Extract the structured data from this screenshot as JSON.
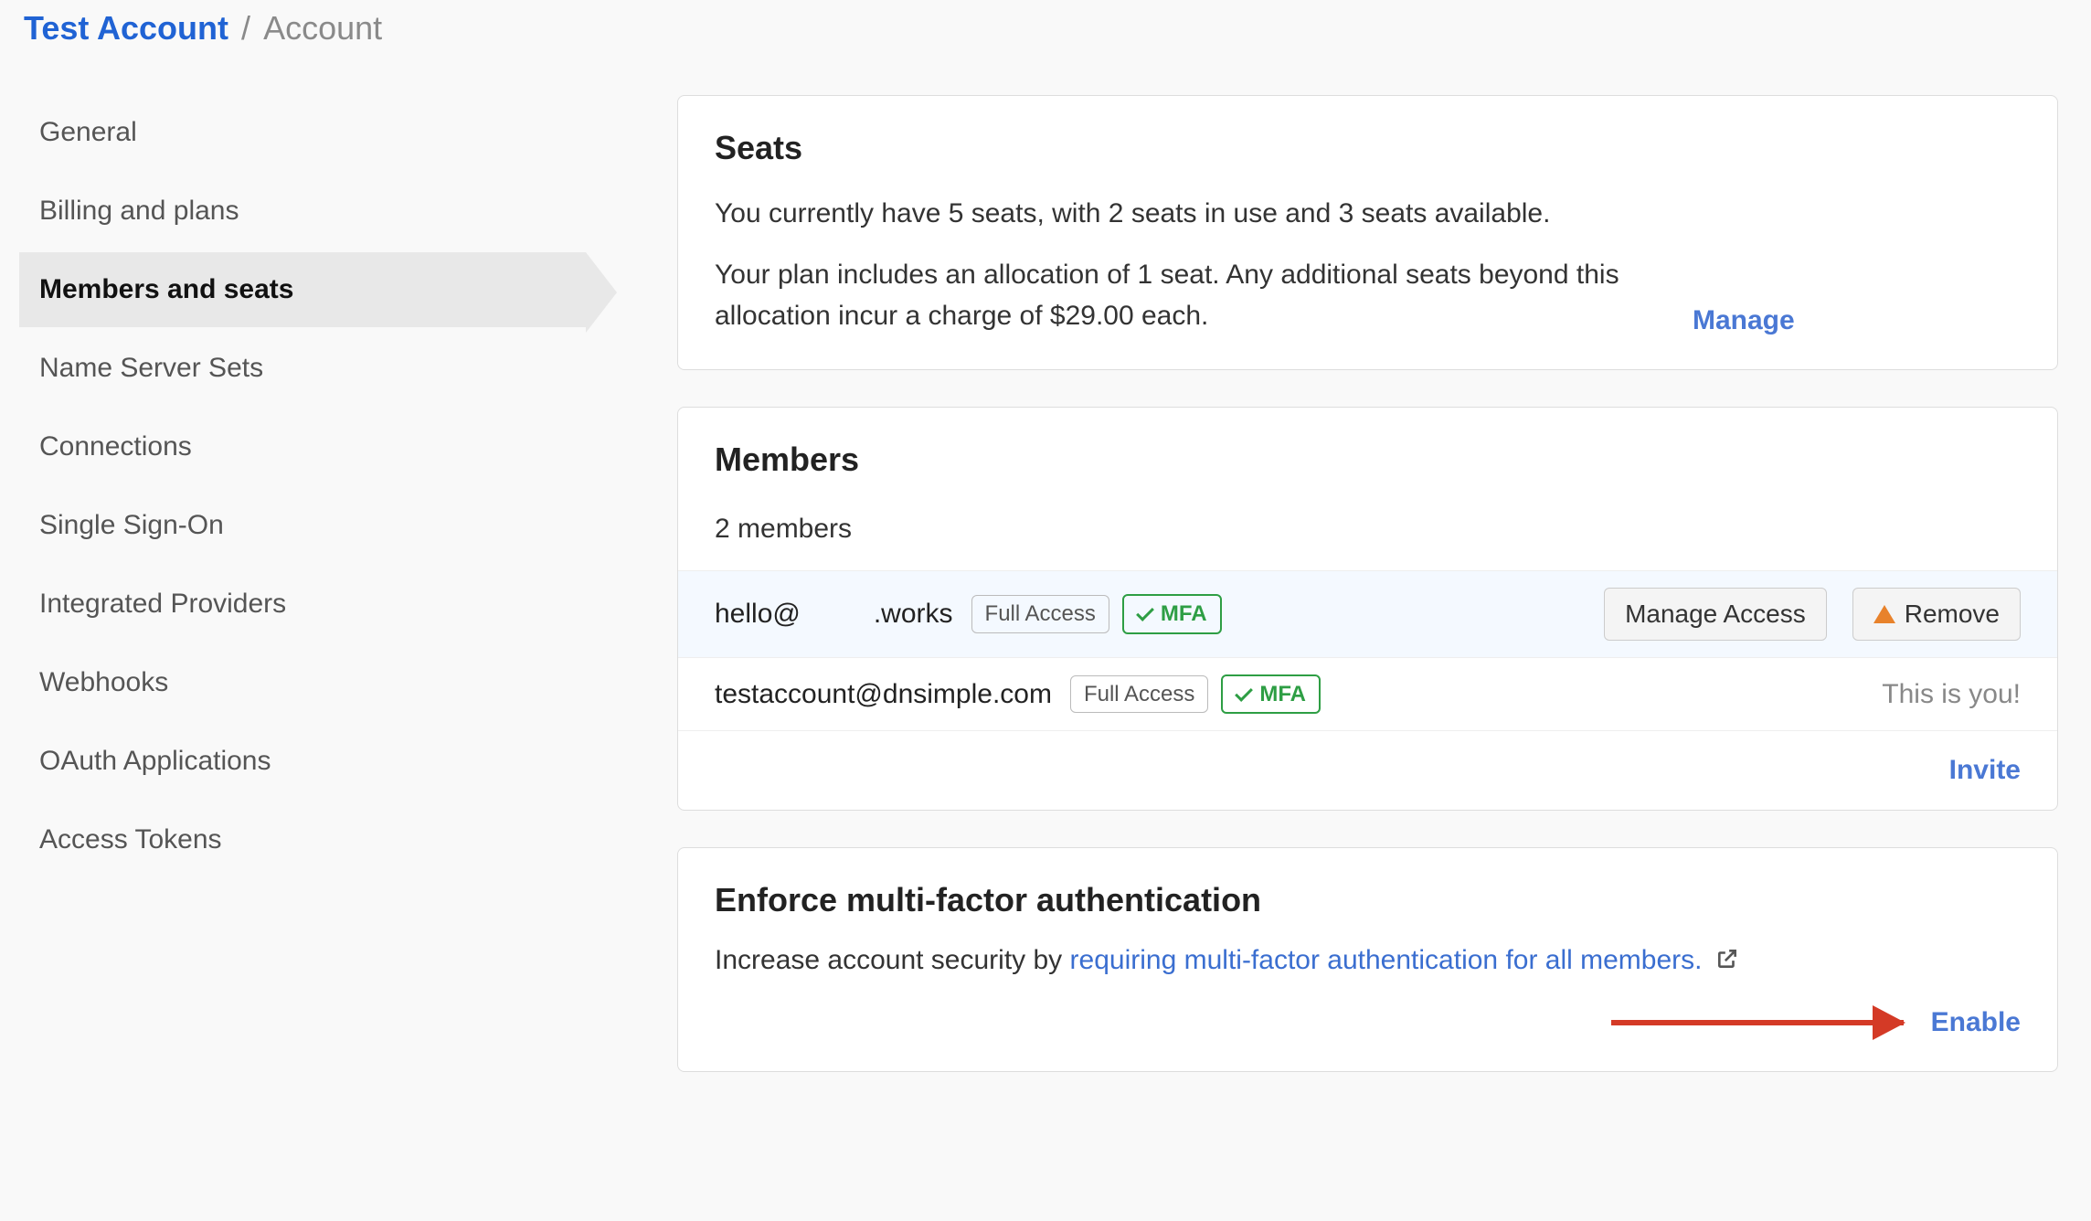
{
  "breadcrumb": {
    "account_link": "Test Account",
    "separator": "/",
    "current": "Account"
  },
  "sidebar": {
    "items": [
      {
        "label": "General"
      },
      {
        "label": "Billing and plans"
      },
      {
        "label": "Members and seats"
      },
      {
        "label": "Name Server Sets"
      },
      {
        "label": "Connections"
      },
      {
        "label": "Single Sign-On"
      },
      {
        "label": "Integrated Providers"
      },
      {
        "label": "Webhooks"
      },
      {
        "label": "OAuth Applications"
      },
      {
        "label": "Access Tokens"
      }
    ],
    "active_index": 2
  },
  "seats_card": {
    "title": "Seats",
    "line1": "You currently have 5 seats, with 2 seats in use and 3 seats available.",
    "line2": "Your plan includes an allocation of 1 seat. Any additional seats beyond this allocation incur a charge of $29.00 each.",
    "manage_label": "Manage"
  },
  "members_card": {
    "title": "Members",
    "count_text": "2 members",
    "rows": [
      {
        "email_prefix": "hello@",
        "email_suffix": ".works",
        "access_label": "Full Access",
        "mfa_label": "MFA",
        "manage_access_label": "Manage Access",
        "remove_label": "Remove"
      },
      {
        "email_full": "testaccount@dnsimple.com",
        "access_label": "Full Access",
        "mfa_label": "MFA",
        "you_label": "This is you!"
      }
    ],
    "invite_label": "Invite"
  },
  "mfa_card": {
    "title": "Enforce multi-factor authentication",
    "lead_text": "Increase account security by ",
    "link_text": "requiring multi-factor authentication for all members.",
    "enable_label": "Enable"
  }
}
